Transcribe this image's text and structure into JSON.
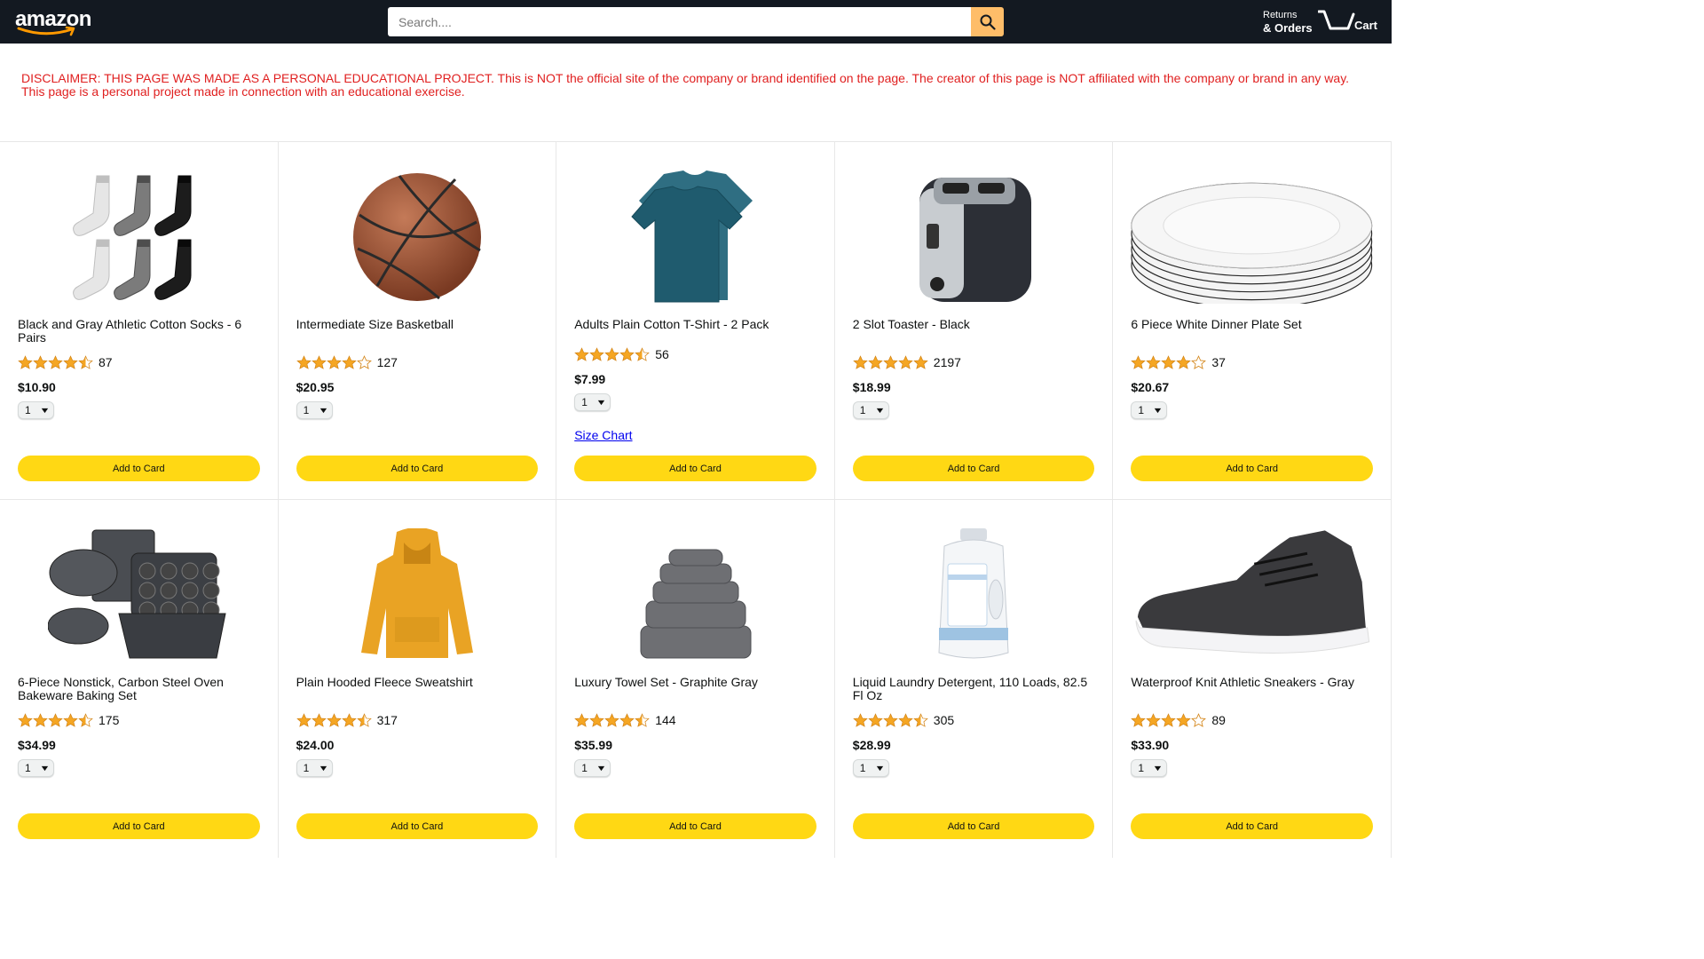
{
  "header": {
    "logo_text": "amazon",
    "search_placeholder": "Search....",
    "returns_line1": "Returns",
    "returns_line2": "& Orders",
    "cart_label": "Cart",
    "colors": {
      "bg": "#131921",
      "search_btn": "#febd69"
    }
  },
  "disclaimer": "DISCLAIMER: THIS PAGE WAS MADE AS A PERSONAL EDUCATIONAL PROJECT. This is NOT the official site of the company or brand identified on the page. The creator of this page is NOT affiliated with the company or brand in any way. This page is a personal project made in connection with an educational exercise.",
  "add_button_label": "Add to Card",
  "size_chart_label": "Size Chart",
  "products": [
    {
      "name": "Black and Gray Athletic Cotton Socks - 6 Pairs",
      "rating": 4.5,
      "rating_count": "87",
      "price": "$10.90",
      "qty": "1",
      "image": "socks"
    },
    {
      "name": "Intermediate Size Basketball",
      "rating": 4.0,
      "rating_count": "127",
      "price": "$20.95",
      "qty": "1",
      "image": "basketball"
    },
    {
      "name": "Adults Plain Cotton T-Shirt - 2 Pack",
      "rating": 4.5,
      "rating_count": "56",
      "price": "$7.99",
      "qty": "1",
      "image": "tshirt",
      "size_chart": true
    },
    {
      "name": "2 Slot Toaster - Black",
      "rating": 5.0,
      "rating_count": "2197",
      "price": "$18.99",
      "qty": "1",
      "image": "toaster"
    },
    {
      "name": "6 Piece White Dinner Plate Set",
      "rating": 4.0,
      "rating_count": "37",
      "price": "$20.67",
      "qty": "1",
      "image": "plates"
    },
    {
      "name": "6-Piece Nonstick, Carbon Steel Oven Bakeware Baking Set",
      "rating": 4.5,
      "rating_count": "175",
      "price": "$34.99",
      "qty": "1",
      "image": "bakeware"
    },
    {
      "name": "Plain Hooded Fleece Sweatshirt",
      "rating": 4.5,
      "rating_count": "317",
      "price": "$24.00",
      "qty": "1",
      "image": "hoodie"
    },
    {
      "name": "Luxury Towel Set - Graphite Gray",
      "rating": 4.5,
      "rating_count": "144",
      "price": "$35.99",
      "qty": "1",
      "image": "towels"
    },
    {
      "name": "Liquid Laundry Detergent, 110 Loads, 82.5 Fl Oz",
      "rating": 4.5,
      "rating_count": "305",
      "price": "$28.99",
      "qty": "1",
      "image": "detergent"
    },
    {
      "name": "Waterproof Knit Athletic Sneakers - Gray",
      "rating": 4.0,
      "rating_count": "89",
      "price": "$33.90",
      "qty": "1",
      "image": "sneakers"
    }
  ]
}
